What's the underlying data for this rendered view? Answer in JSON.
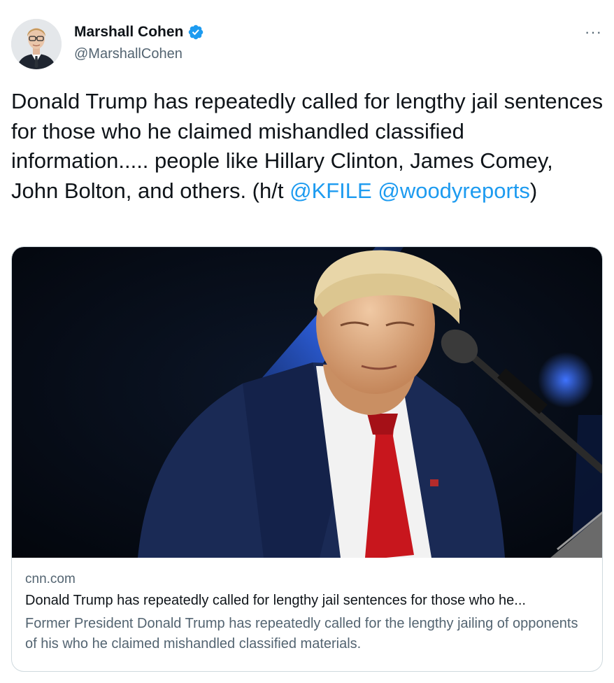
{
  "author": {
    "display_name": "Marshall Cohen",
    "handle": "@MarshallCohen",
    "verified": true,
    "avatar_icon": "profile-photo"
  },
  "more_label": "···",
  "tweet": {
    "text_main": "Donald Trump has repeatedly called for lengthy jail sentences for those who he claimed mishandled classified information..... people like Hillary Clinton, James Comey, John Bolton, and others. (h/t ",
    "mention_1": "@KFILE",
    "mention_2": "@woodyreports",
    "text_end": ")"
  },
  "card": {
    "image_icon": "trump-at-microphone-photo",
    "domain": "cnn.com",
    "title": "Donald Trump has repeatedly called for lengthy jail sentences for those who he...",
    "description": "Former President Donald Trump has repeatedly called for the lengthy jailing of opponents of his who he claimed mishandled classified materials."
  },
  "colors": {
    "link": "#1d9bf0",
    "secondary_text": "#536471",
    "border": "#cfd9de",
    "verified": "#1d9bf0"
  }
}
